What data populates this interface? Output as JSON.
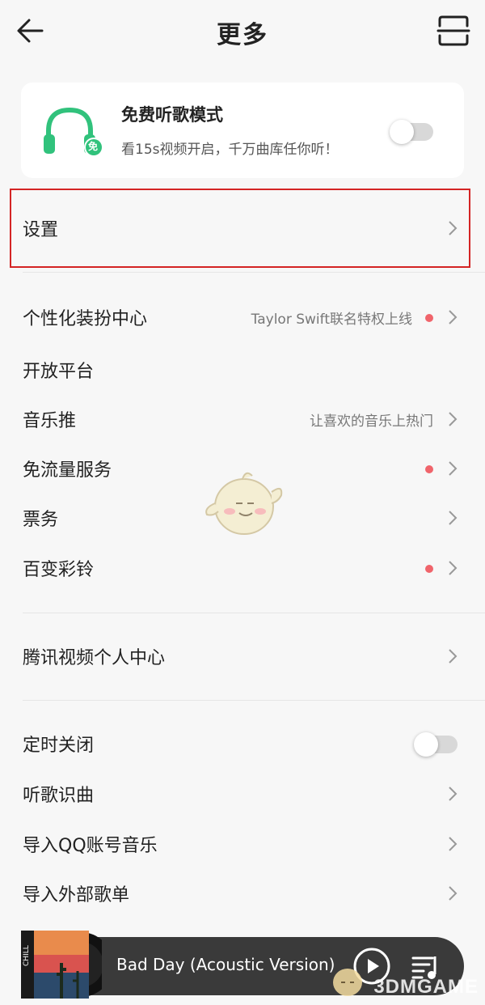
{
  "header": {
    "title": "更多"
  },
  "free_mode": {
    "title": "免费听歌模式",
    "subtitle": "看15s视频开启，千万曲库任你听！",
    "badge": "免",
    "enabled": false
  },
  "settings": {
    "label": "设置"
  },
  "group1": [
    {
      "label": "个性化装扮中心",
      "hint": "Taylor Swift联名特权上线",
      "red_dot": true
    },
    {
      "label": "开放平台"
    },
    {
      "label": "音乐推",
      "hint": "让喜欢的音乐上热门"
    },
    {
      "label": "免流量服务",
      "red_dot": true
    },
    {
      "label": "票务"
    },
    {
      "label": "百变彩铃",
      "red_dot": true
    }
  ],
  "group2": [
    {
      "label": "腾讯视频个人中心"
    }
  ],
  "group3": [
    {
      "label": "定时关闭",
      "toggle": false
    },
    {
      "label": "听歌识曲"
    },
    {
      "label": "导入QQ账号音乐"
    },
    {
      "label": "导入外部歌单"
    }
  ],
  "player": {
    "song": "Bad Day (Acoustic Version)",
    "cover_text": "CHILL"
  },
  "watermark": {
    "text": "3DMGAME"
  },
  "colors": {
    "accent_green": "#31c27c",
    "red_dot": "#f0646b",
    "highlight": "#d42424"
  }
}
